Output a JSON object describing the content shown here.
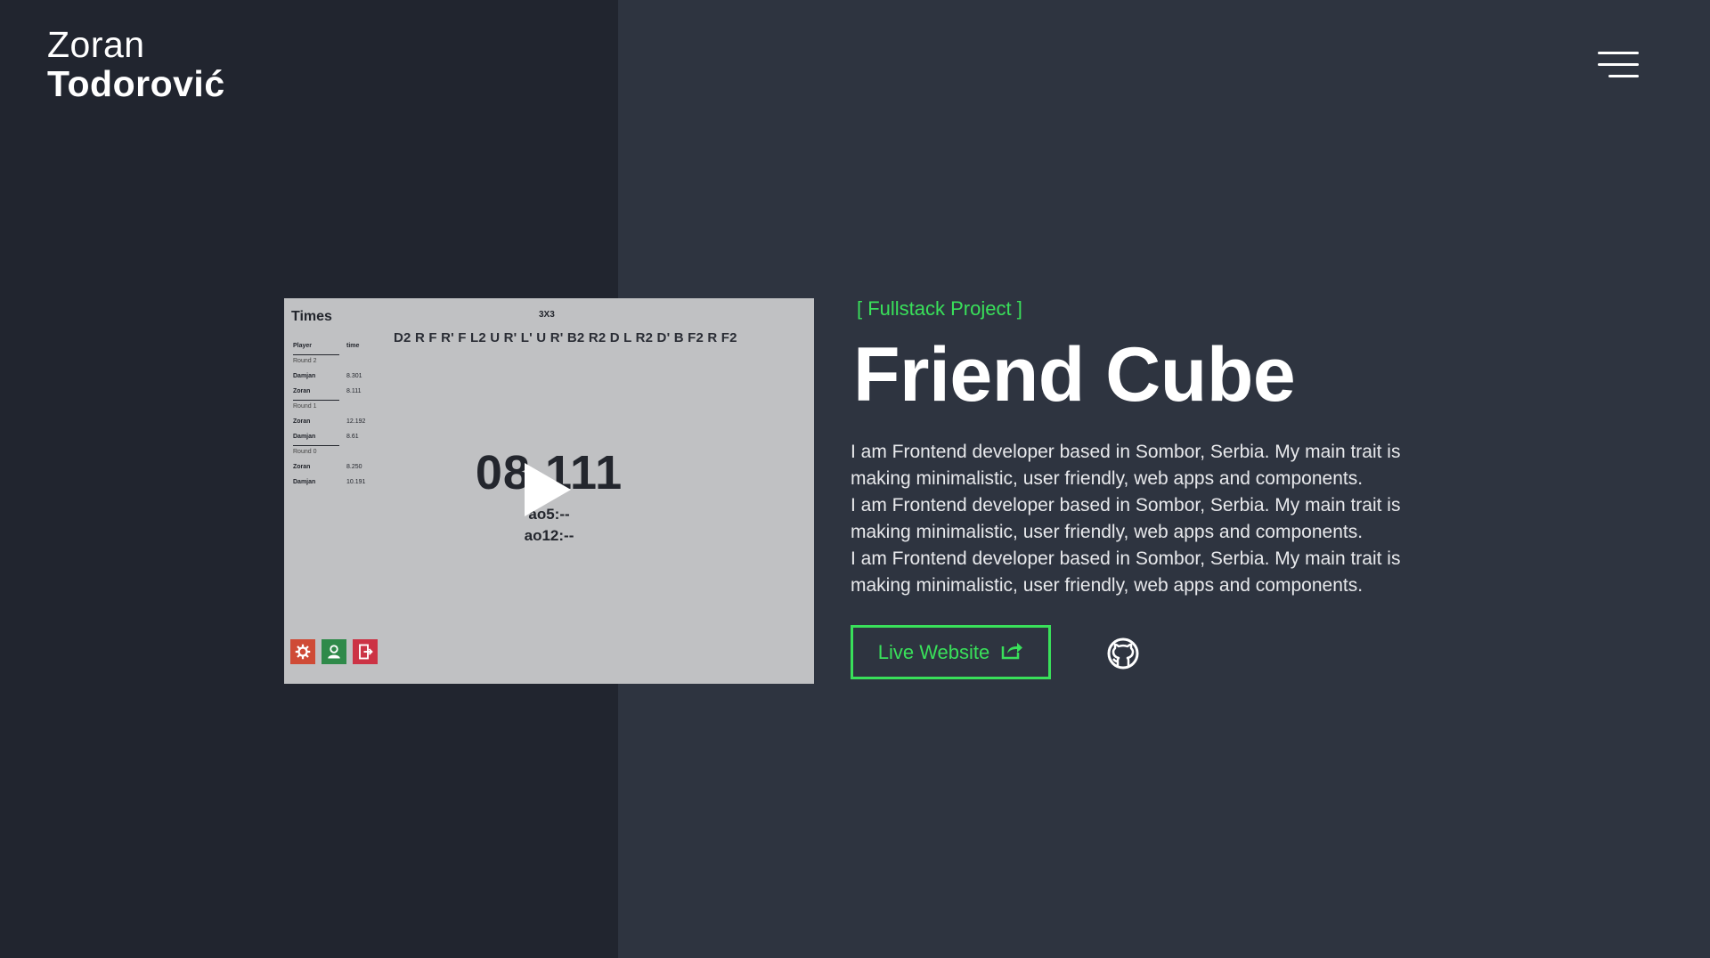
{
  "brand": {
    "first_name": "Zoran",
    "last_name": "Todorović"
  },
  "nav": {
    "menu_icon": "hamburger-menu-icon"
  },
  "project": {
    "category": "[ Fullstack Project ]",
    "title": "Friend Cube",
    "description": [
      "I am Frontend developer based in Sombor, Serbia. My main trait is making  minimalistic, user friendly, web apps and components.",
      "I am Frontend developer based in Sombor, Serbia. My main trait is making  minimalistic, user friendly, web apps and components.",
      "I am Frontend developer based in Sombor, Serbia. My main trait is making  minimalistic, user friendly, web apps and components."
    ],
    "live_label": "Live Website",
    "live_icon": "external-share-icon",
    "github_icon": "github-icon"
  },
  "preview": {
    "times_title": "Times",
    "cube_type": "3X3",
    "scramble": "D2 R F R' F L2 U R' L' U R' B2 R2 D L R2 D' B F2 R F2",
    "table": {
      "headers": [
        "Player",
        "time"
      ],
      "rounds": [
        {
          "label": "Round 2",
          "rows": [
            [
              "Damjan",
              "8.301"
            ],
            [
              "Zoran",
              "8.111"
            ]
          ]
        },
        {
          "label": "Round 1",
          "rows": [
            [
              "Zoran",
              "12.192"
            ],
            [
              "Damjan",
              "8.61"
            ]
          ]
        },
        {
          "label": "Round 0",
          "rows": [
            [
              "Zoran",
              "8.250"
            ],
            [
              "Damjan",
              "10.191"
            ]
          ]
        }
      ]
    },
    "timer": "08.111",
    "ao5": "ao5:--",
    "ao12": "ao12:--",
    "play_icon": "play-icon",
    "toolbar_icons": [
      "settings-icon",
      "user-icon",
      "exit-icon"
    ]
  },
  "colors": {
    "accent": "#39e05a",
    "background": "#2e3440",
    "left_panel": "#21252f",
    "settings_button": "#cf4b36",
    "user_button": "#2f8a4a",
    "exit_button": "#cc3345"
  }
}
